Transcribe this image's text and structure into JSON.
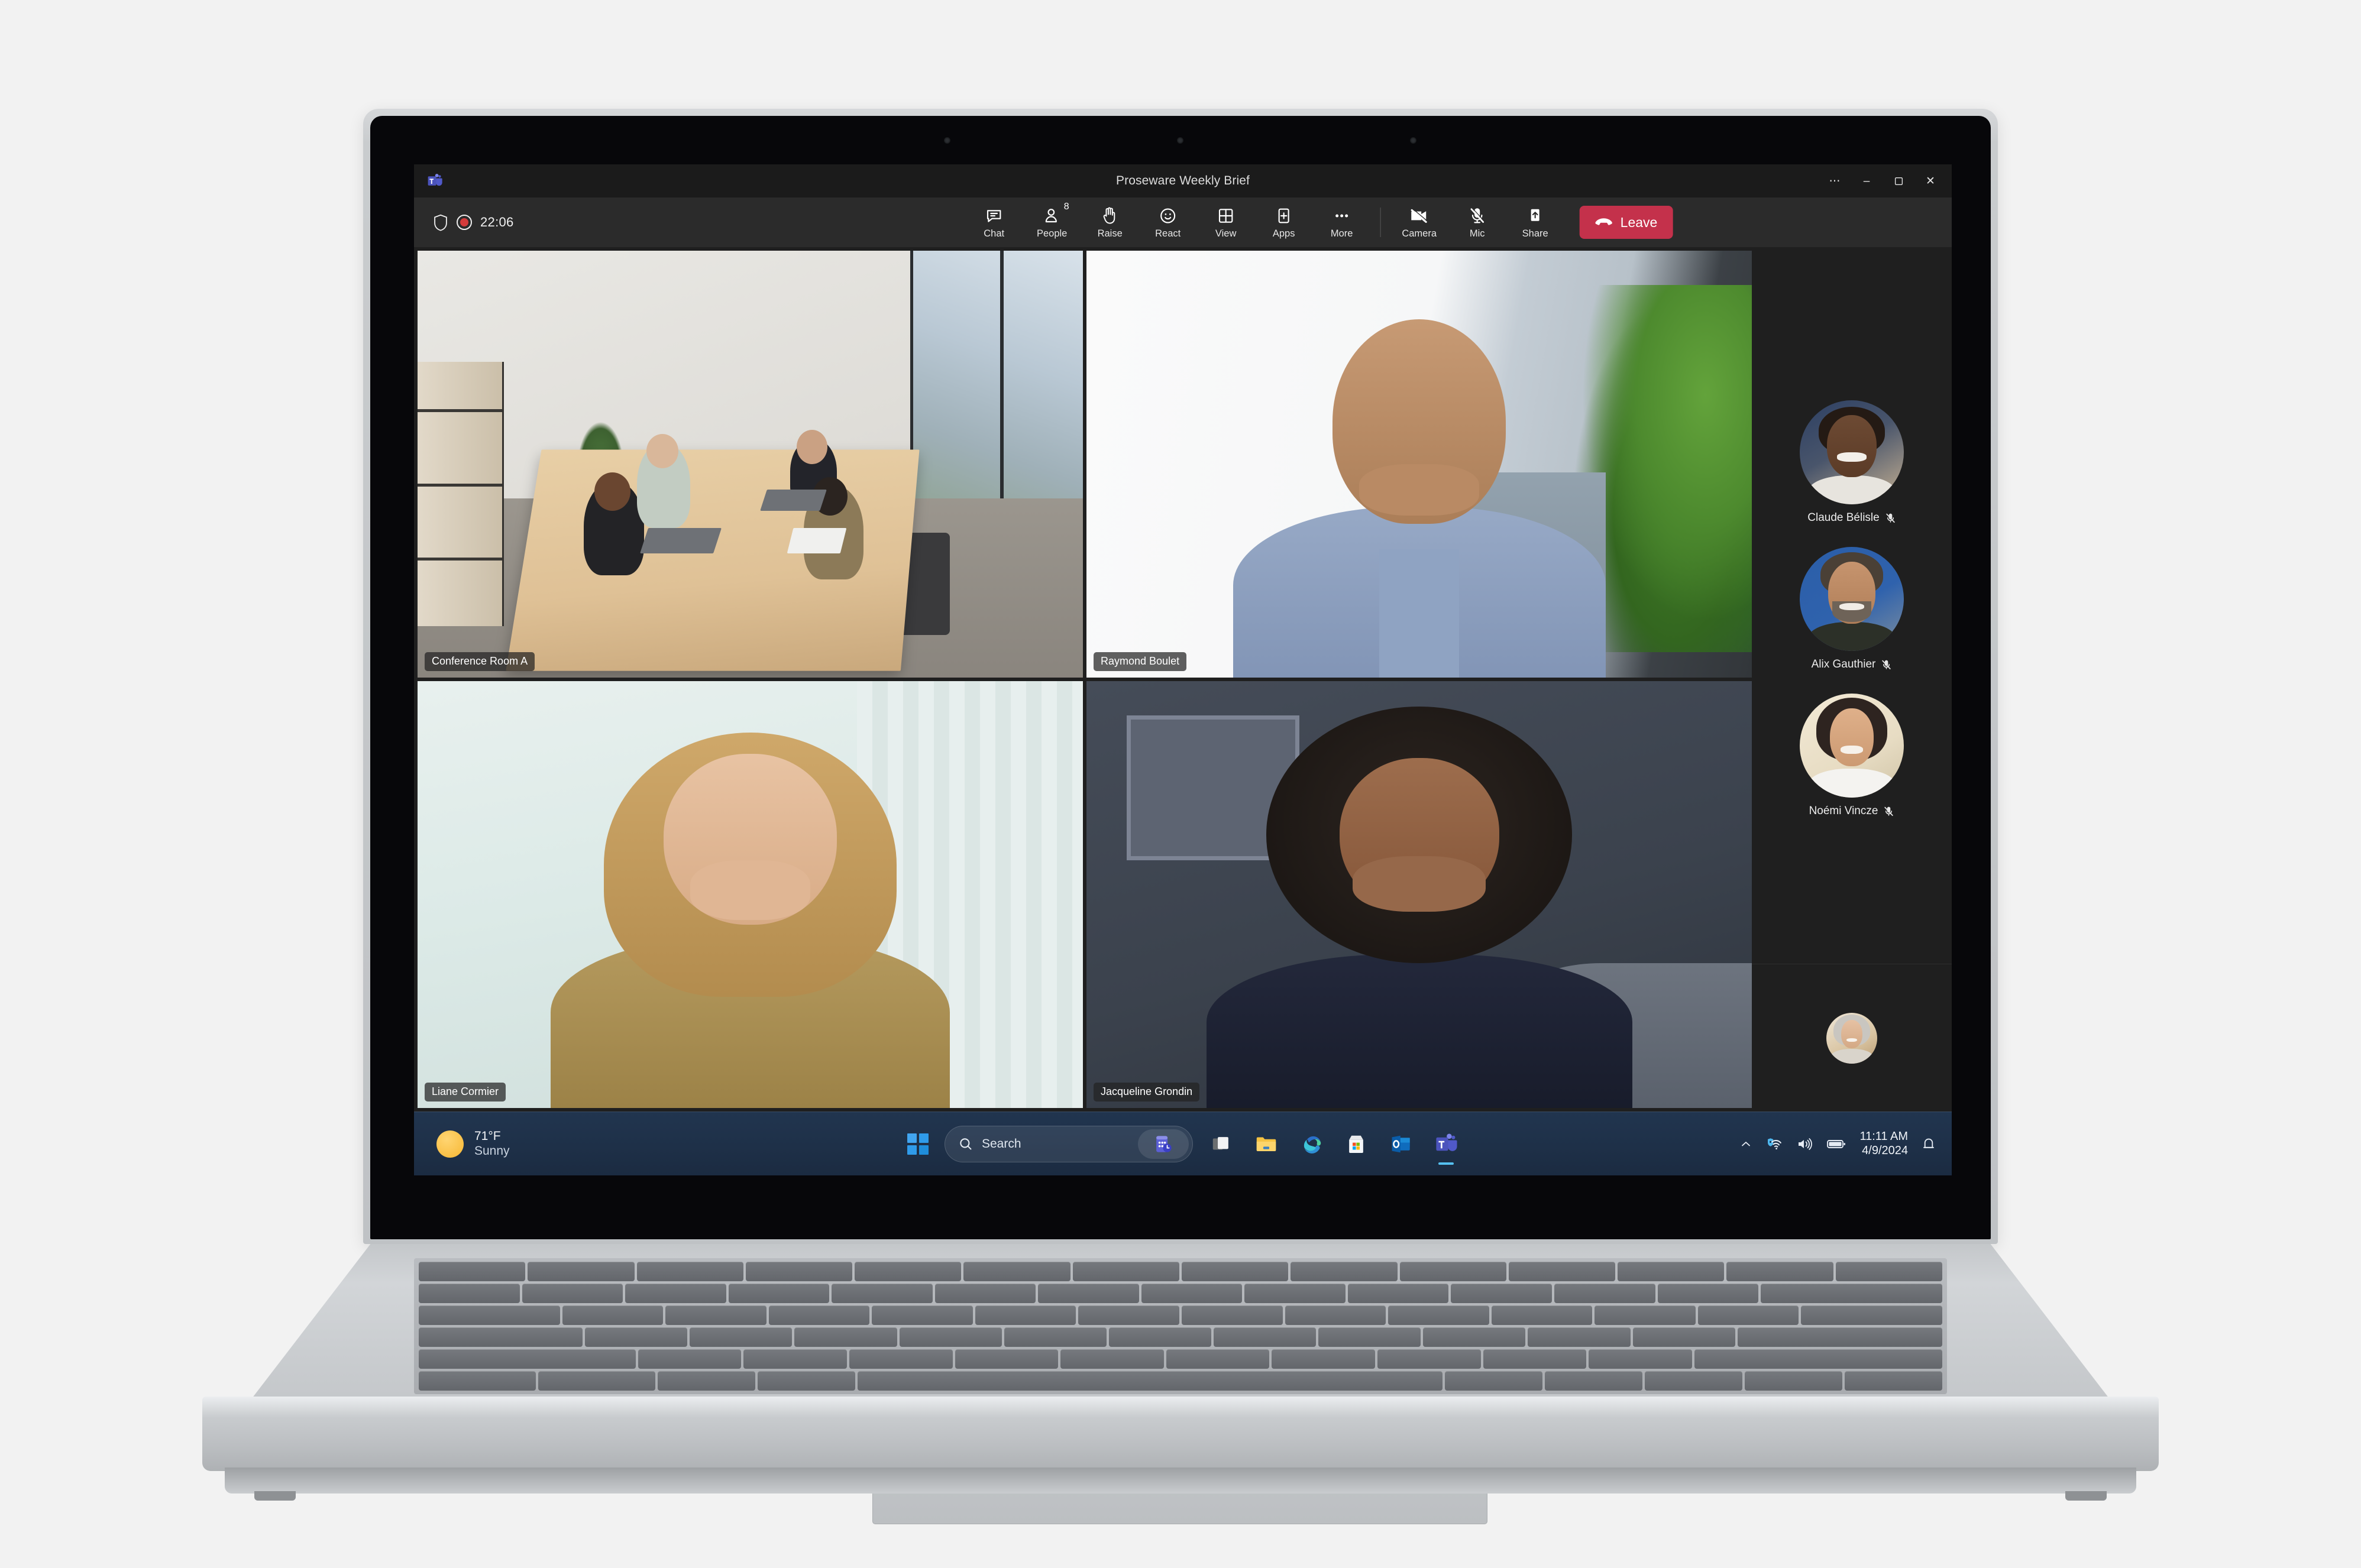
{
  "window": {
    "title": "Proseware Weekly Brief",
    "app_icon": "teams-icon",
    "controls": {
      "more": "⋯",
      "minimize": "–",
      "restore": "❐",
      "close": "✕"
    }
  },
  "meeting": {
    "shield_icon": "shield-icon",
    "recording_icon": "recording-icon",
    "elapsed": "22:06",
    "toolbar": [
      {
        "label": "Chat",
        "icon": "chat-icon"
      },
      {
        "label": "People",
        "icon": "people-icon",
        "badge": "8"
      },
      {
        "label": "Raise",
        "icon": "raise-hand-icon"
      },
      {
        "label": "React",
        "icon": "react-icon"
      },
      {
        "label": "View",
        "icon": "view-grid-icon"
      },
      {
        "label": "Apps",
        "icon": "apps-plus-icon"
      },
      {
        "label": "More",
        "icon": "more-ellipsis-icon"
      }
    ],
    "toolbar_right": [
      {
        "label": "Camera",
        "icon": "camera-off-icon"
      },
      {
        "label": "Mic",
        "icon": "mic-off-icon"
      },
      {
        "label": "Share",
        "icon": "share-up-icon"
      }
    ],
    "leave": {
      "label": "Leave",
      "icon": "hangup-icon",
      "color": "#c4314b"
    },
    "active_speaker_color": "#9e9ef0"
  },
  "tiles": [
    {
      "name": "Conference Room A",
      "active": true
    },
    {
      "name": "Raymond Boulet",
      "active": false
    },
    {
      "name": "Liane Cormier",
      "active": false
    },
    {
      "name": "Jacqueline Grondin",
      "active": false
    }
  ],
  "roster": [
    {
      "name": "Claude Bélisle",
      "muted": true,
      "mute_icon": "mic-off-icon"
    },
    {
      "name": "Alix Gauthier",
      "muted": true,
      "mute_icon": "mic-off-icon"
    },
    {
      "name": "Noémi Vincze",
      "muted": true,
      "mute_icon": "mic-off-icon"
    }
  ],
  "self_view": {
    "avatar": "self-avatar"
  },
  "taskbar": {
    "weather": {
      "temp": "71°F",
      "condition": "Sunny",
      "icon": "sun-icon"
    },
    "start": "start-button",
    "search": {
      "placeholder": "Search",
      "value": "",
      "icon": "search-icon",
      "widget_icon": "search-highlights-icon"
    },
    "apps": [
      {
        "name": "task-view",
        "icon": "task-view-icon",
        "active": false
      },
      {
        "name": "file-explorer",
        "icon": "folder-icon",
        "active": false
      },
      {
        "name": "microsoft-edge",
        "icon": "edge-icon",
        "active": false
      },
      {
        "name": "microsoft-store",
        "icon": "store-icon",
        "active": false
      },
      {
        "name": "outlook",
        "icon": "outlook-icon",
        "active": false
      },
      {
        "name": "microsoft-teams",
        "icon": "teams-icon",
        "active": true
      }
    ],
    "tray": {
      "chevron": "chevron-up-icon",
      "network": "wifi-secure-icon",
      "volume": "volume-icon",
      "battery": "battery-icon",
      "time": "11:11 AM",
      "date": "4/9/2024",
      "notifications": "bell-icon"
    }
  }
}
